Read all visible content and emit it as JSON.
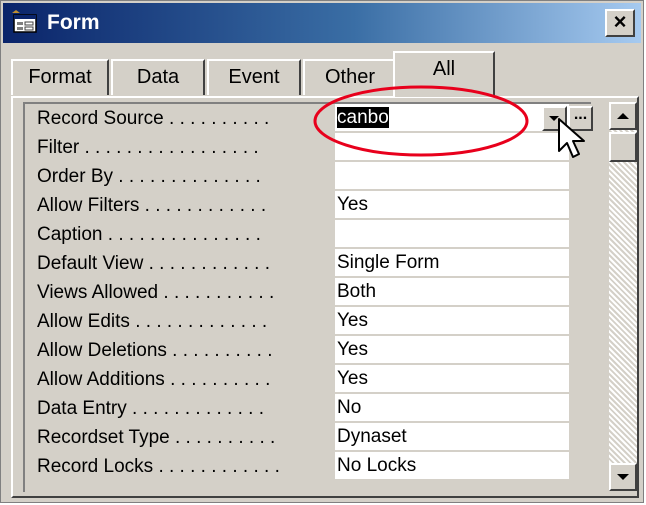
{
  "window": {
    "title": "Form",
    "close_label": "×"
  },
  "tabs": [
    {
      "label": "Format",
      "active": false
    },
    {
      "label": "Data",
      "active": false
    },
    {
      "label": "Event",
      "active": false
    },
    {
      "label": "Other",
      "active": false
    },
    {
      "label": "All",
      "active": true
    }
  ],
  "properties": [
    {
      "label": "Record Source . . . . . . . . . .",
      "value": "canbo",
      "selected": true
    },
    {
      "label": "Filter . . . . . . . . . . . . . . . . .",
      "value": ""
    },
    {
      "label": "Order By . . . . . . . . . . . . . .",
      "value": ""
    },
    {
      "label": "Allow Filters . . . . . . . . . . . .",
      "value": "Yes"
    },
    {
      "label": "Caption . . . . . . . . . . . . . . .",
      "value": ""
    },
    {
      "label": "Default View . . . . . . . . . . . .",
      "value": "Single Form"
    },
    {
      "label": "Views Allowed . . . . . . . . . . .",
      "value": "Both"
    },
    {
      "label": "Allow Edits . . . . . . . . . . . . .",
      "value": "Yes"
    },
    {
      "label": "Allow Deletions . . . . . . . . . .",
      "value": "Yes"
    },
    {
      "label": "Allow Additions . . . . . . . . . .",
      "value": "Yes"
    },
    {
      "label": "Data Entry . . . . . . . . . . . . .",
      "value": "No"
    },
    {
      "label": "Recordset Type . . . . . . . . . .",
      "value": "Dynaset"
    },
    {
      "label": "Record Locks . . . . . . . . . . . .",
      "value": "No Locks"
    }
  ],
  "build_button_label": "...",
  "icons": {
    "form": "form-icon",
    "dropdown": "dropdown-arrow-icon",
    "scroll_up": "scroll-up-icon",
    "scroll_down": "scroll-down-icon",
    "cursor": "mouse-pointer-icon"
  },
  "colors": {
    "titlebar_start": "#0a246a",
    "titlebar_end": "#a6caf0",
    "annotation": "#e8001c",
    "selection": "#000000"
  }
}
